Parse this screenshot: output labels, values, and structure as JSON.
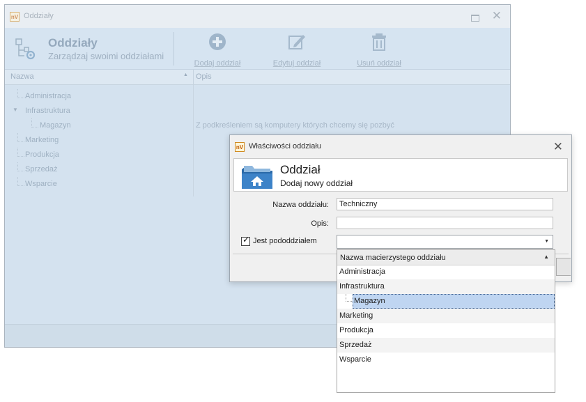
{
  "background_window": {
    "title": "Oddziały",
    "ribbon": {
      "title": "Oddziały",
      "subtitle": "Zarządzaj swoimi oddziałami",
      "buttons": [
        {
          "label": "Dodaj oddział",
          "icon": "plus-circle-icon"
        },
        {
          "label": "Edytuj oddział",
          "icon": "edit-pencil-icon"
        },
        {
          "label": "Usuń oddział",
          "icon": "trash-icon"
        }
      ]
    },
    "table": {
      "columns": [
        "Nazwa",
        "Opis"
      ],
      "rows": [
        {
          "name": "Administracja",
          "desc": "",
          "level": 0
        },
        {
          "name": "Infrastruktura",
          "desc": "",
          "level": 0,
          "expanded": true
        },
        {
          "name": "Magazyn",
          "desc": "Z podkreśleniem są komputery których chcemy się pozbyć",
          "level": 1
        },
        {
          "name": "Marketing",
          "desc": "",
          "level": 0
        },
        {
          "name": "Produkcja",
          "desc": "",
          "level": 0
        },
        {
          "name": "Sprzedaż",
          "desc": "",
          "level": 0
        },
        {
          "name": "Wsparcie",
          "desc": "",
          "level": 0
        }
      ]
    }
  },
  "dialog": {
    "title": "Właściwości oddziału",
    "header": {
      "title": "Oddział",
      "subtitle": "Dodaj nowy oddział"
    },
    "fields": {
      "name_label": "Nazwa oddziału:",
      "name_value": "Techniczny",
      "desc_label": "Opis:",
      "desc_value": "",
      "is_sub_label": "Jest pododdziałem",
      "is_sub_checked": true
    }
  },
  "dropdown": {
    "column_header": "Nazwa macierzystego oddziału",
    "items": [
      {
        "label": "Administracja",
        "level": 0
      },
      {
        "label": "Infrastruktura",
        "level": 0
      },
      {
        "label": "Magazyn",
        "level": 1,
        "selected": true
      },
      {
        "label": "Marketing",
        "level": 0
      },
      {
        "label": "Produkcja",
        "level": 0
      },
      {
        "label": "Sprzedaż",
        "level": 0
      },
      {
        "label": "Wsparcie",
        "level": 0
      }
    ]
  },
  "colors": {
    "accent_selection": "#bfd5f1",
    "app_icon_orange": "#d08a20",
    "overlay_blue": "#d2dfec"
  }
}
